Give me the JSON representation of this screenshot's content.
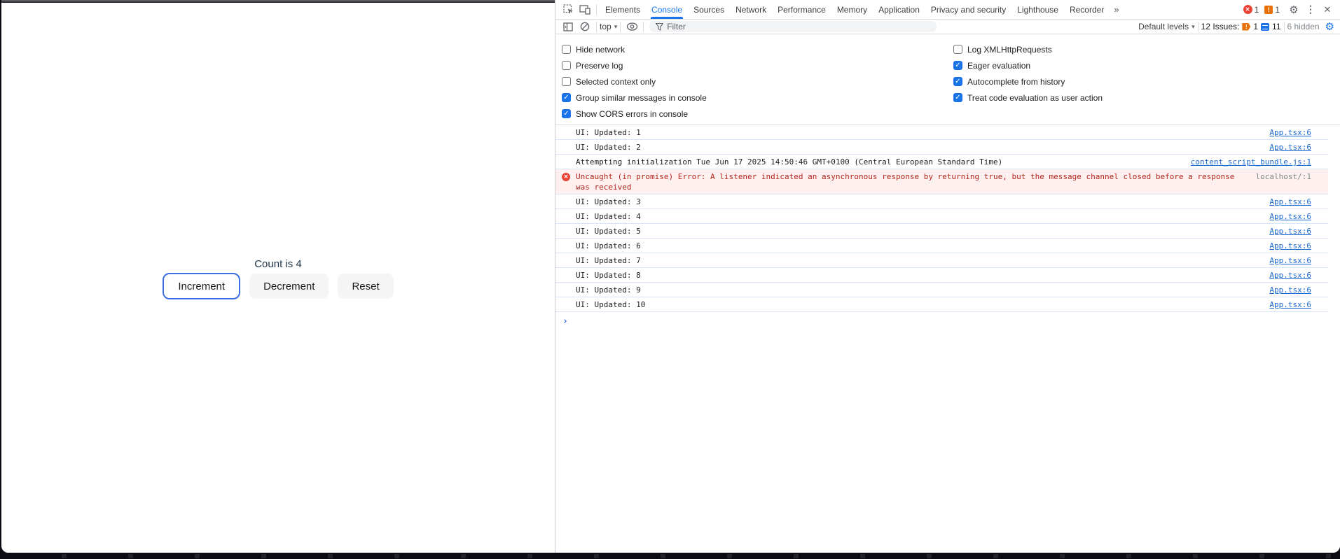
{
  "colors": {
    "accent": "#1a73e8",
    "link": "#1967d2",
    "error_background": "#fdf0ef",
    "error_text": "#b3261e",
    "error_badge": "#ea4335",
    "warning_badge": "#e8710a",
    "row_divider": "#dbe6f9",
    "muted": "#5f6368",
    "focus_ring": "#3e6fe1",
    "count_label_color": "#213547"
  },
  "icons": {
    "gear": "⚙",
    "kebab": "⋮",
    "close": "✕",
    "caret": "▾",
    "check": "✓",
    "bang": "!",
    "error_x": "✕",
    "prompt": "›",
    "more_tabs": "»"
  },
  "app": {
    "count_label": "Count is 4",
    "buttons": [
      "Increment",
      "Decrement",
      "Reset"
    ]
  },
  "devtools": {
    "tabbar": {
      "tabs": [
        "Elements",
        "Console",
        "Sources",
        "Network",
        "Performance",
        "Memory",
        "Application",
        "Privacy and security",
        "Lighthouse",
        "Recorder"
      ],
      "active_tab": "Console",
      "error_count": "1",
      "warning_count": "1"
    },
    "toolbar": {
      "context_selector": "top",
      "filter_placeholder": "Filter",
      "levels_selector": "Default levels",
      "issues_label": "12 Issues:",
      "issues_breakpoint_count": "1",
      "issues_message_count": "11",
      "hidden_label": "6 hidden"
    },
    "settings": {
      "left": [
        {
          "label": "Hide network",
          "checked": false
        },
        {
          "label": "Preserve log",
          "checked": false
        },
        {
          "label": "Selected context only",
          "checked": false
        },
        {
          "label": "Group similar messages in console",
          "checked": true
        },
        {
          "label": "Show CORS errors in console",
          "checked": true
        }
      ],
      "right": [
        {
          "label": "Log XMLHttpRequests",
          "checked": false
        },
        {
          "label": "Eager evaluation",
          "checked": true
        },
        {
          "label": "Autocomplete from history",
          "checked": true
        },
        {
          "label": "Treat code evaluation as user action",
          "checked": true
        }
      ]
    },
    "console": {
      "messages": [
        {
          "type": "log",
          "text": "UI: Updated: 1",
          "source": "App.tsx:6"
        },
        {
          "type": "log",
          "text": "UI: Updated: 2",
          "source": "App.tsx:6"
        },
        {
          "type": "log",
          "text": "Attempting initialization Tue Jun 17 2025 14:50:46 GMT+0100 (Central European Standard Time)",
          "source": "content_script_bundle.js:1"
        },
        {
          "type": "error",
          "text": "Uncaught (in promise) Error: A listener indicated an asynchronous response by returning true, but the message channel closed before a response was received",
          "source": "localhost/:1"
        },
        {
          "type": "log",
          "text": "UI: Updated: 3",
          "source": "App.tsx:6"
        },
        {
          "type": "log",
          "text": "UI: Updated: 4",
          "source": "App.tsx:6"
        },
        {
          "type": "log",
          "text": "UI: Updated: 5",
          "source": "App.tsx:6"
        },
        {
          "type": "log",
          "text": "UI: Updated: 6",
          "source": "App.tsx:6"
        },
        {
          "type": "log",
          "text": "UI: Updated: 7",
          "source": "App.tsx:6"
        },
        {
          "type": "log",
          "text": "UI: Updated: 8",
          "source": "App.tsx:6"
        },
        {
          "type": "log",
          "text": "UI: Updated: 9",
          "source": "App.tsx:6"
        },
        {
          "type": "log",
          "text": "UI: Updated: 10",
          "source": "App.tsx:6"
        }
      ],
      "prompt": "›"
    }
  }
}
